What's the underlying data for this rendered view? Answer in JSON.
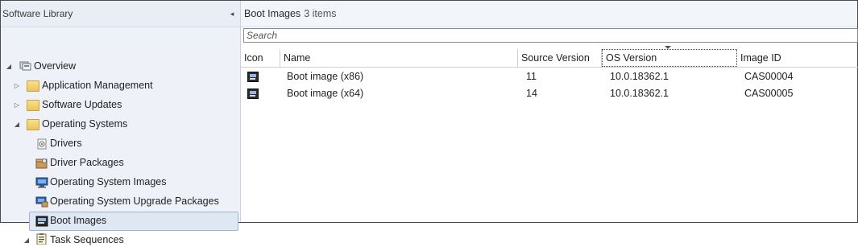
{
  "nav": {
    "title": "Software Library",
    "collapse_glyph": "◂",
    "items": [
      {
        "label": "Overview",
        "icon": "overview-icon",
        "expander": "◢"
      },
      {
        "label": "Application Management",
        "icon": "folder-icon",
        "expander": "▷"
      },
      {
        "label": "Software Updates",
        "icon": "folder-icon",
        "expander": "▷"
      },
      {
        "label": "Operating Systems",
        "icon": "folder-icon",
        "expander": "◢"
      },
      {
        "label": "Drivers",
        "icon": "drivers-icon"
      },
      {
        "label": "Driver Packages",
        "icon": "driver-packages-icon"
      },
      {
        "label": "Operating System Images",
        "icon": "os-images-icon"
      },
      {
        "label": "Operating System Upgrade Packages",
        "icon": "os-upgrade-packages-icon"
      },
      {
        "label": "Boot Images",
        "icon": "boot-images-icon",
        "selected": true
      },
      {
        "label": "Task Sequences",
        "icon": "task-sequences-icon",
        "expander": "◢"
      }
    ]
  },
  "main": {
    "title": "Boot Images",
    "count": "3 items",
    "search_placeholder": "Search",
    "columns": [
      "Icon",
      "Name",
      "Source Version",
      "OS Version",
      "Image ID"
    ],
    "sorted_column": "OS Version",
    "rows": [
      {
        "name": "Boot image (x86)",
        "source_version": "11",
        "os_version": "10.0.18362.1",
        "image_id": "CAS00004"
      },
      {
        "name": "Boot image (x64)",
        "source_version": "14",
        "os_version": "10.0.18362.1",
        "image_id": "CAS00005"
      }
    ]
  },
  "colors": {
    "nav_bg": "#eef2f8",
    "selection": "#dfe7f3",
    "selection_border": "#9fb4d2"
  }
}
